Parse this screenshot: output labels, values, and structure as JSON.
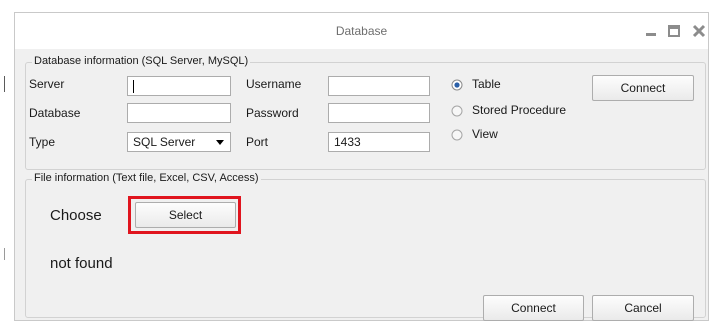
{
  "window": {
    "title": "Database",
    "controls": [
      "minimize-icon",
      "maximize-icon",
      "close-icon"
    ]
  },
  "db_group": {
    "legend": "Database information (SQL Server, MySQL)",
    "server_label": "Server",
    "server_value": "",
    "database_label": "Database",
    "database_value": "",
    "type_label": "Type",
    "type_value": "SQL Server",
    "username_label": "Username",
    "username_value": "",
    "password_label": "Password",
    "password_value": "",
    "port_label": "Port",
    "port_value": "1433",
    "radio_options": [
      {
        "label": "Table",
        "selected": true
      },
      {
        "label": "Stored Procedure",
        "selected": false
      },
      {
        "label": "View",
        "selected": false
      }
    ],
    "connect_label": "Connect"
  },
  "file_group": {
    "legend": "File information (Text file, Excel, CSV, Access)",
    "choose_label": "Choose",
    "select_label": "Select",
    "status_text": "not found",
    "highlight_color": "#e0141e"
  },
  "footer": {
    "connect_label": "Connect",
    "cancel_label": "Cancel"
  }
}
